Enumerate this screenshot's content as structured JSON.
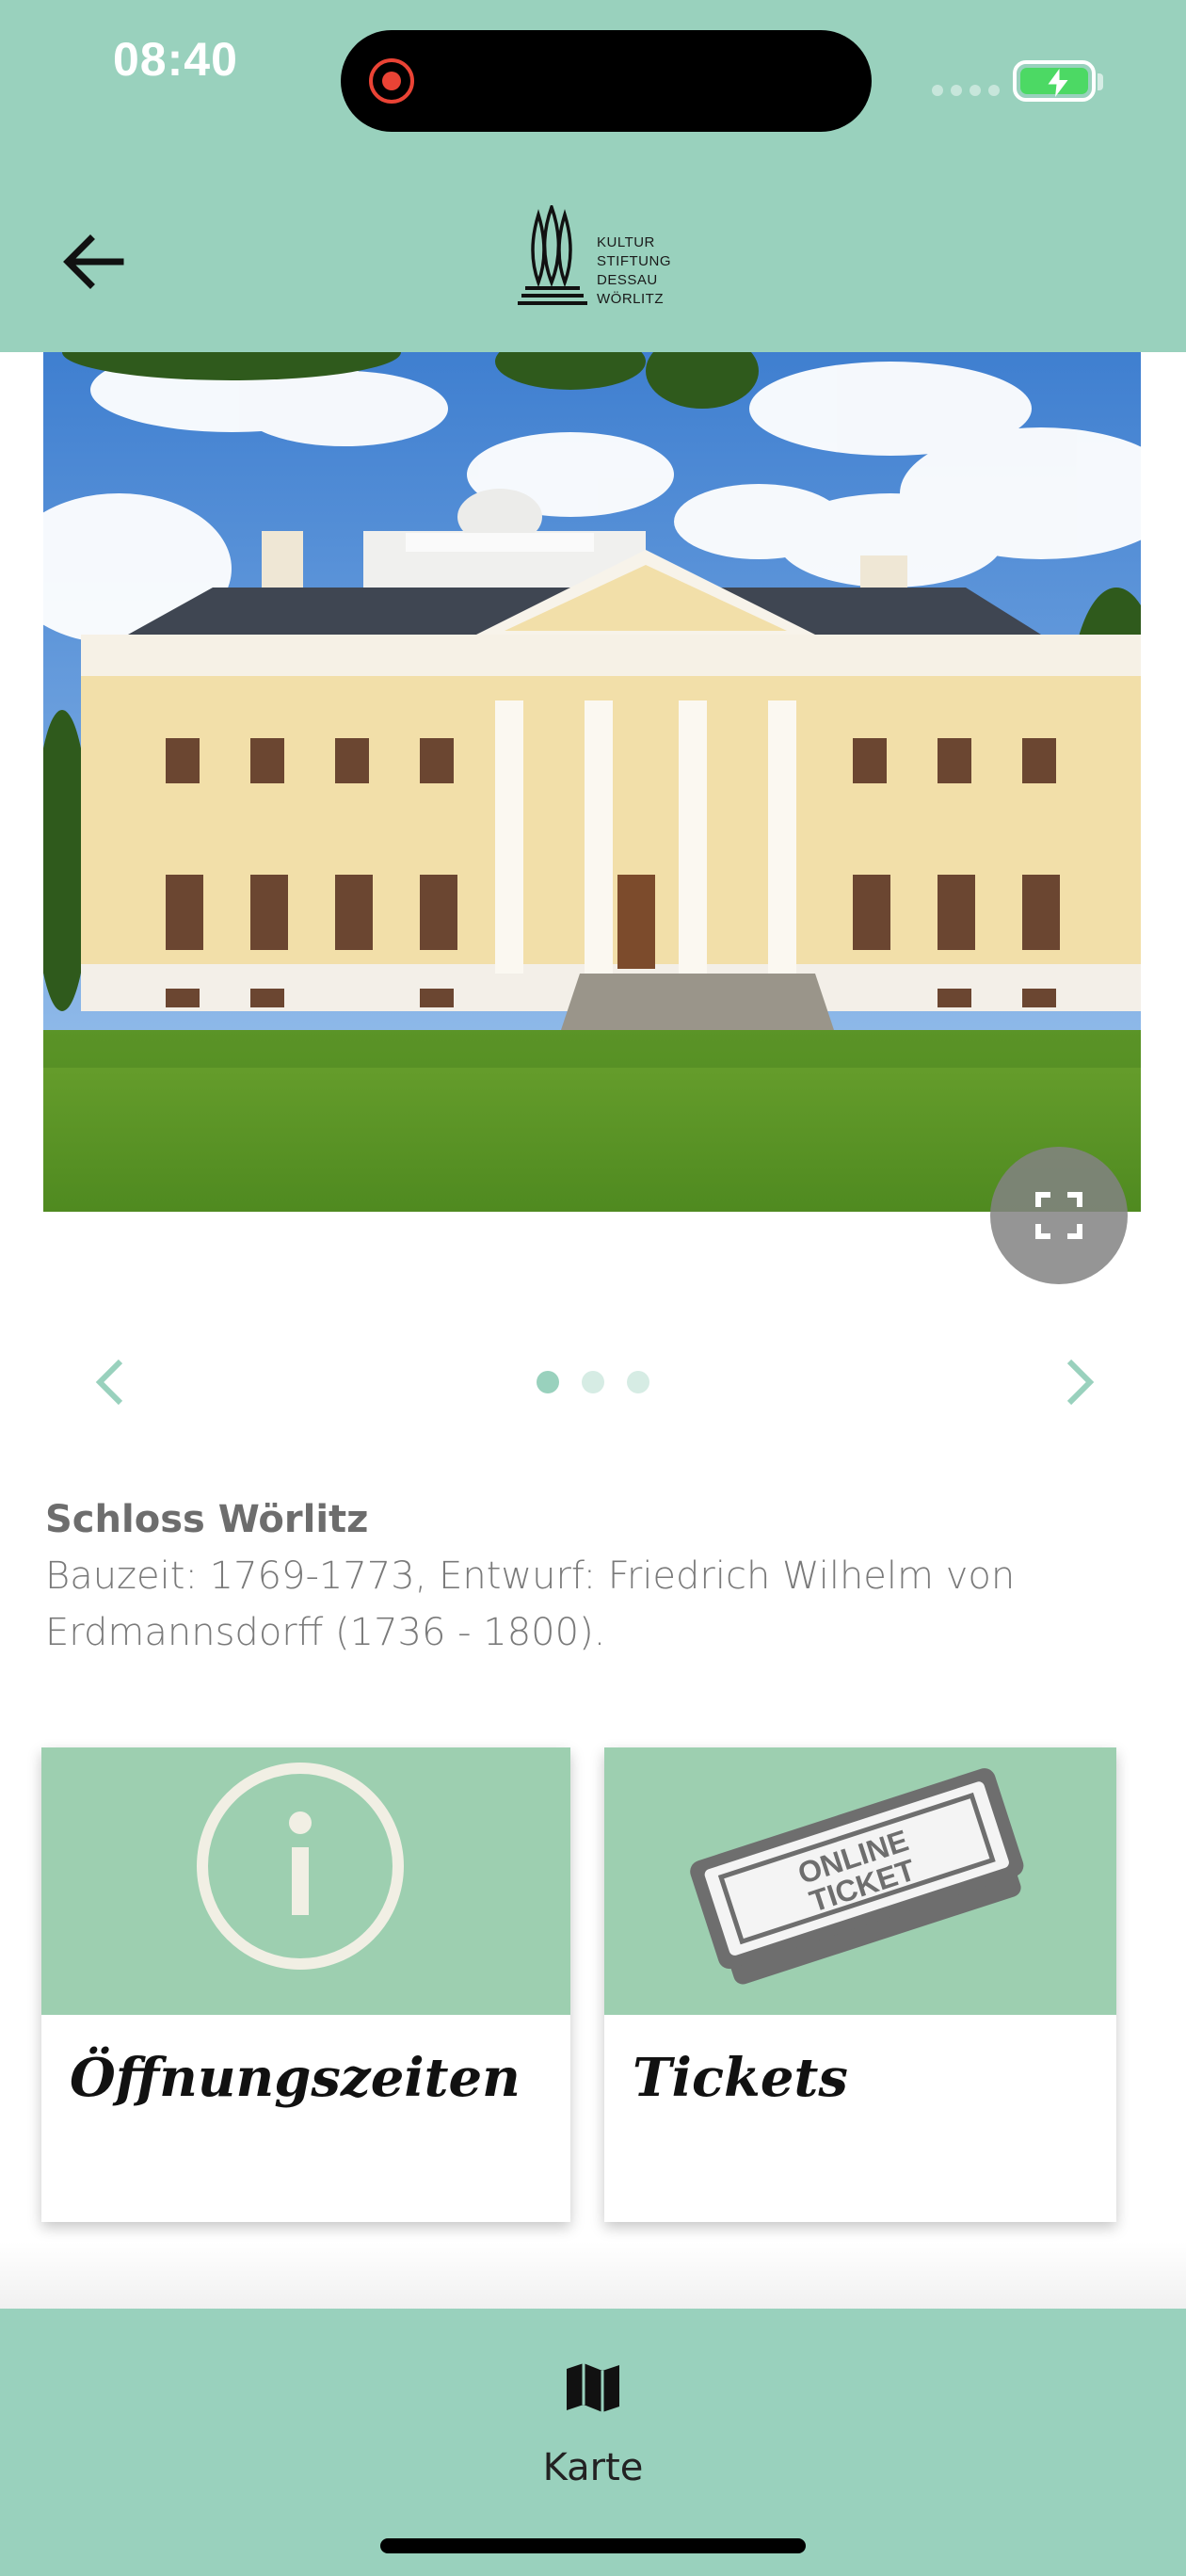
{
  "status_bar": {
    "time": "08:40"
  },
  "header": {
    "logo_lines": [
      "KULTUR",
      "STIFTUNG",
      "DESSAU",
      "WÖRLITZ"
    ]
  },
  "gallery": {
    "slide_count": 3,
    "active_slide": 1
  },
  "description": {
    "title": "Schloss Wörlitz",
    "body": "Bauzeit: 1769-1773, Entwurf: Friedrich Wilhelm von Erdmannsdorff (1736 - 1800)."
  },
  "cards": [
    {
      "label": "Öffnungszeiten",
      "icon": "info-icon"
    },
    {
      "label": "Tickets",
      "icon": "ticket-icon",
      "icon_text": [
        "ONLINE",
        "TICKET"
      ]
    }
  ],
  "bottom_nav": {
    "map_label": "Karte"
  },
  "colors": {
    "accent": "#99d1bd",
    "card_top": "#9dcfb0"
  }
}
